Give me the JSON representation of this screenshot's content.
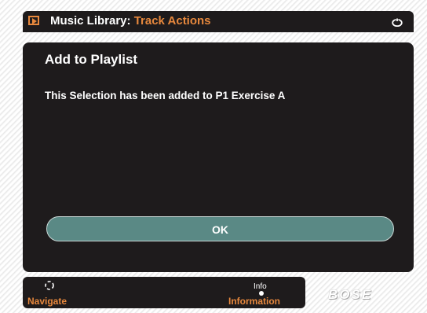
{
  "header": {
    "title_main": "Music Library:",
    "title_sub": "Track Actions",
    "menu_icon": "play-box-icon",
    "power_icon": "power-icon"
  },
  "dialog": {
    "title": "Add to Playlist",
    "message": "This Selection has been added to P1 Exercise A",
    "ok_label": "OK"
  },
  "footer": {
    "navigate_label": "Navigate",
    "navigate_icon": "navigation-ring-icon",
    "info_small_label": "Info",
    "info_label": "Information"
  },
  "brand": {
    "logo_text": "BOSE"
  },
  "colors": {
    "panel_bg": "#1e1b1c",
    "accent_orange": "#e7883d",
    "button_teal": "#5a8985"
  }
}
